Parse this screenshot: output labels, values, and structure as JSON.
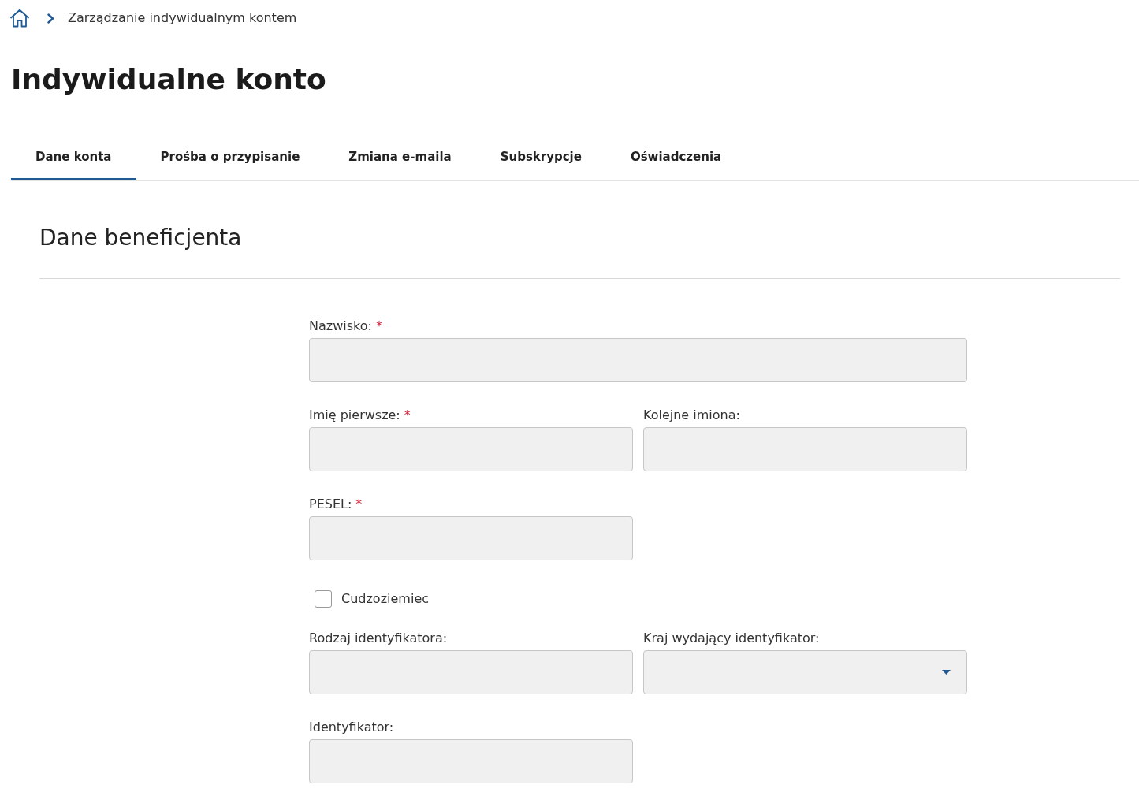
{
  "breadcrumb": {
    "items": [
      {
        "label": "Zarządzanie indywidualnym kontem"
      }
    ]
  },
  "page_title": "Indywidualne konto",
  "tabs": [
    {
      "label": "Dane konta",
      "selected": true
    },
    {
      "label": "Prośba o przypisanie",
      "selected": false
    },
    {
      "label": "Zmiana e-maila",
      "selected": false
    },
    {
      "label": "Subskrypcje",
      "selected": false
    },
    {
      "label": "Oświadczenia",
      "selected": false
    }
  ],
  "section": {
    "title": "Dane beneficjenta",
    "rows": [
      {
        "fields": [
          {
            "kind": "text",
            "label": "Nazwisko:",
            "required_mark": "*",
            "full_width": true
          }
        ]
      },
      {
        "fields": [
          {
            "kind": "text",
            "label": "Imię pierwsze:",
            "required_mark": "*",
            "full_width": false
          },
          {
            "kind": "text",
            "label": "Kolejne imiona:",
            "full_width": false
          }
        ]
      },
      {
        "fields": [
          {
            "kind": "text",
            "label": "PESEL:",
            "required_mark": "*",
            "full_width": false
          }
        ]
      },
      {
        "fields": [
          {
            "kind": "checkbox",
            "label": "Cudzoziemiec",
            "checked": false
          }
        ]
      },
      {
        "fields": [
          {
            "kind": "text",
            "label": "Rodzaj identyfikatora:",
            "full_width": false
          },
          {
            "kind": "select",
            "label": "Kraj wydający identyfikator:",
            "full_width": false
          }
        ]
      },
      {
        "fields": [
          {
            "kind": "text",
            "label": "Identyfikator:",
            "full_width": false
          }
        ]
      }
    ]
  }
}
